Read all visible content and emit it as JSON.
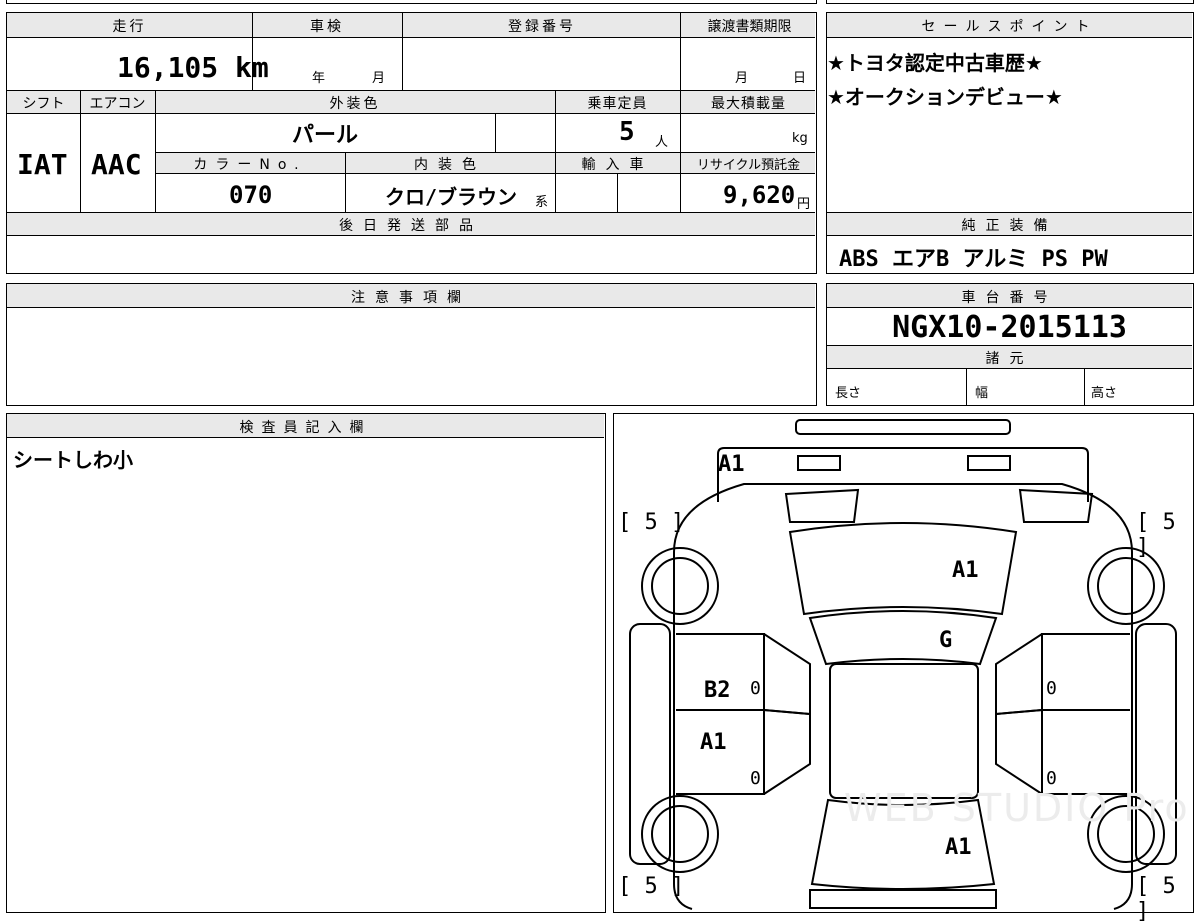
{
  "labels": {
    "mileage": "走行",
    "inspection": "車検",
    "registration_no": "登録番号",
    "transfer_doc_deadline": "譲渡書類期限",
    "shift": "シフト",
    "aircon": "エアコン",
    "exterior_color": "外装色",
    "capacity": "乗車定員",
    "max_load": "最大積載量",
    "color_no": "カラーNo.",
    "interior_color": "内装色",
    "import": "輸入車",
    "recycle_fee": "リサイクル預託金",
    "later_parts": "後日発送部品",
    "sales_points": "セールスポイント",
    "standard_equipment": "純正装備",
    "notes": "注意事項欄",
    "chassis_no": "車台番号",
    "specs": "諸元",
    "length": "長さ",
    "width": "幅",
    "height": "高さ",
    "inspector_notes": "検査員記入欄"
  },
  "units": {
    "year": "年",
    "month": "月",
    "day": "日",
    "person": "人",
    "kg": "kg",
    "yen": "円",
    "series": "系"
  },
  "values": {
    "mileage": "16,105 km",
    "shift": "IAT",
    "aircon": "AAC",
    "exterior_color": "パール",
    "capacity": "5",
    "color_no": "070",
    "interior_color": "クロ/ブラウン",
    "recycle_fee": "9,620",
    "chassis_no": "NGX10-2015113",
    "standard_equipment": "ABS エアB アルミ PS PW",
    "inspector_notes": "シートしわ小"
  },
  "sales_points": [
    "★トヨタ認定中古車歴★",
    "★オークションデビュー★"
  ],
  "diagram": {
    "tire_marks": [
      "[ 5 ]",
      "[ 5 ]",
      "[ 5 ]",
      "[ 5 ]"
    ],
    "damage": {
      "front_bumper": "A1",
      "hood": "A1",
      "windshield": "G",
      "front_door_left": "B2",
      "rear_door_left": "A1",
      "trunk": "A1"
    },
    "zero_marks": [
      "0",
      "0",
      "0",
      "0"
    ],
    "watermark": "WEB STUDIO Pro"
  }
}
